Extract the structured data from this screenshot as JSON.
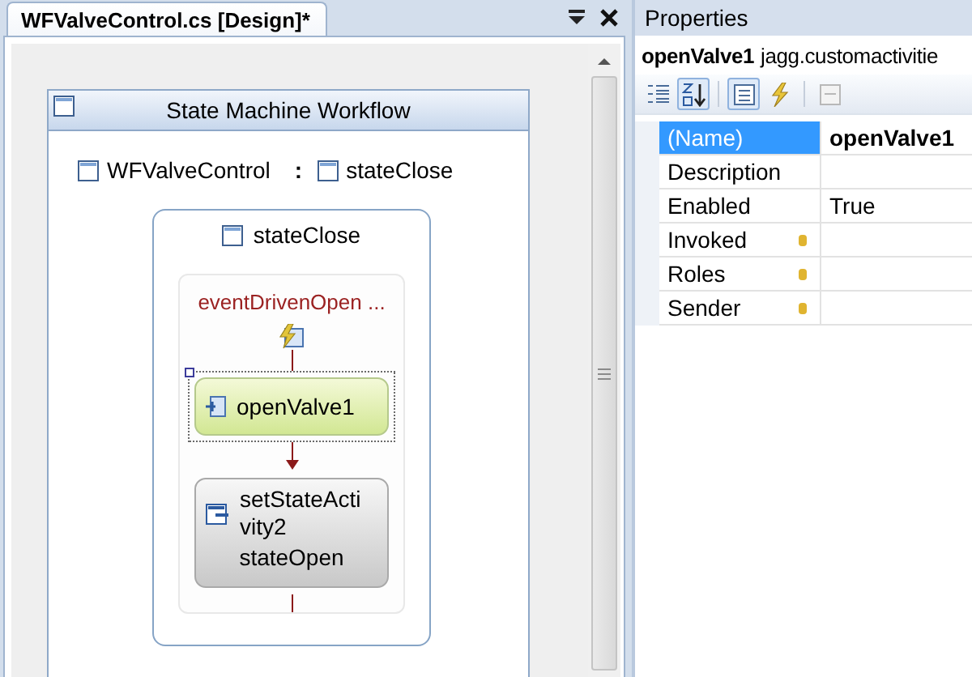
{
  "document_tab": {
    "title": "WFValveControl.cs [Design]*",
    "selected": true
  },
  "workflow": {
    "title": "State Machine Workflow",
    "root": "WFValveControl",
    "separator": ":",
    "current_state": "stateClose",
    "state": {
      "name": "stateClose",
      "event_driven": {
        "name": "eventDrivenOpen ...",
        "activities": [
          {
            "kind": "invoke",
            "name": "openValve1",
            "selected": true
          },
          {
            "kind": "set_state",
            "name": "setStateActivity2",
            "target": "stateOpen",
            "selected": false
          }
        ]
      }
    }
  },
  "properties": {
    "title": "Properties",
    "object_name": "openValve1",
    "object_type": "jagg.customactivitie",
    "toolbar": [
      {
        "kind": "categorized",
        "selected": false
      },
      {
        "kind": "alphabetical",
        "selected": true
      },
      {
        "kind": "properties",
        "selected": true
      },
      {
        "kind": "events",
        "selected": false
      },
      {
        "kind": "pages",
        "selected": false
      }
    ],
    "rows": [
      {
        "name": "(Name)",
        "value": "openValve1",
        "selected": true,
        "modified": true,
        "bindable": false
      },
      {
        "name": "Description",
        "selected": false,
        "bindable": false
      },
      {
        "name": "Enabled",
        "value": "True",
        "selected": false,
        "modified": false,
        "bindable": false
      },
      {
        "name": "Invoked",
        "selected": false,
        "bindable": true
      },
      {
        "name": "Roles",
        "selected": false,
        "bindable": true
      },
      {
        "name": "Sender",
        "selected": false,
        "bindable": true
      }
    ]
  }
}
